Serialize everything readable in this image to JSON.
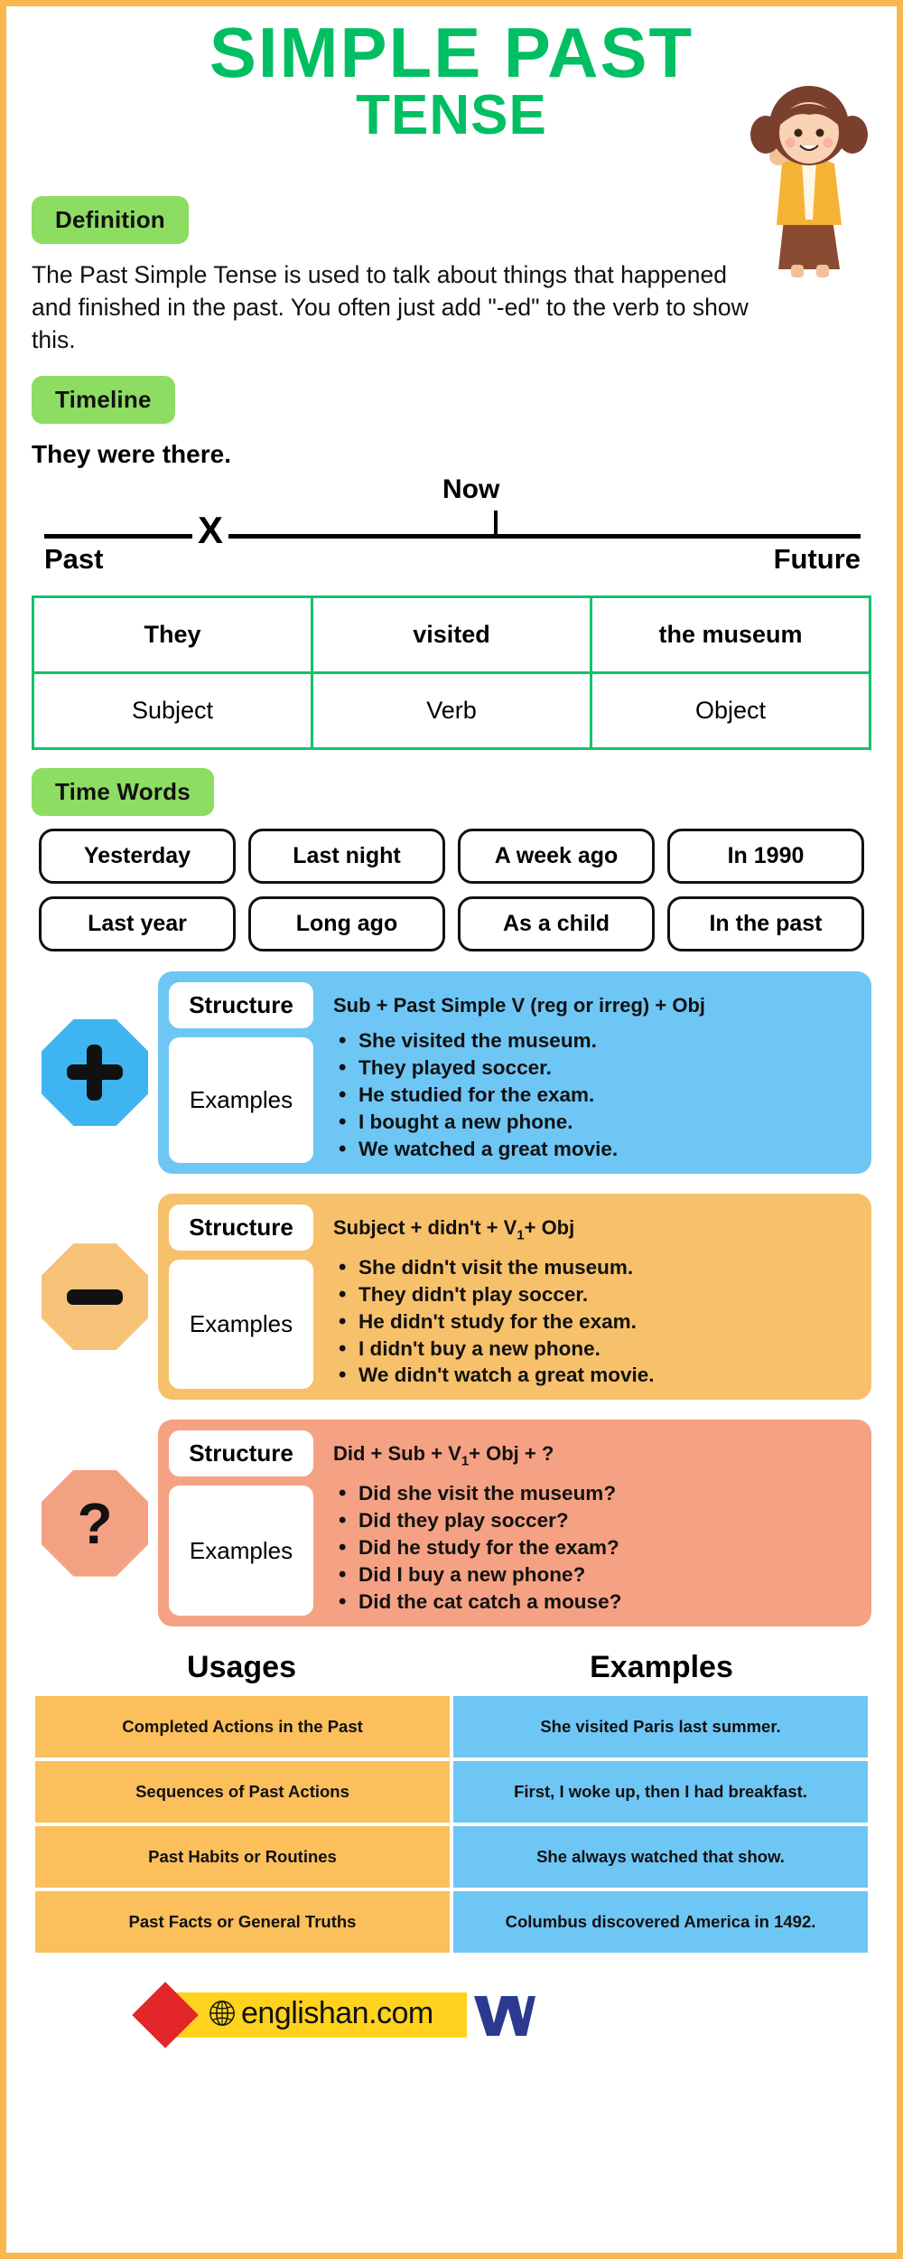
{
  "title": {
    "line1": "SIMPLE PAST",
    "line2": "TENSE"
  },
  "definition": {
    "badge": "Definition",
    "text": "The Past Simple Tense is used to talk about things that happened and finished in the past. You often just add \"-ed\" to the verb to show this."
  },
  "timeline": {
    "badge": "Timeline",
    "sentence": "They were there.",
    "now_label": "Now",
    "past_label": "Past",
    "future_label": "Future",
    "marker": "X"
  },
  "svo_table": {
    "examples": [
      "They",
      "visited",
      "the museum"
    ],
    "labels": [
      "Subject",
      "Verb",
      "Object"
    ]
  },
  "time_words": {
    "badge": "Time Words",
    "row1": [
      "Yesterday",
      "Last night",
      "A week ago",
      "In 1990"
    ],
    "row2": [
      "Last year",
      "Long ago",
      "As a child",
      "In the past"
    ]
  },
  "forms": [
    {
      "sign": "plus-icon",
      "structure_label": "Structure",
      "examples_label": "Examples",
      "structure": "Sub + Past Simple V (reg or irreg) + Obj",
      "examples": [
        "She visited the museum.",
        "They played soccer.",
        "He studied for the exam.",
        "I bought a new phone.",
        "We watched a great movie."
      ],
      "panel_color": "#6ec6f5",
      "sign_color": "#3eb4f0"
    },
    {
      "sign": "minus-icon",
      "structure_label": "Structure",
      "examples_label": "Examples",
      "structure_prefix": "Subject + didn't + V",
      "structure_sub": "1",
      "structure_suffix": "+ Obj",
      "structure": "Subject + didn't + V1+ Obj",
      "examples": [
        "She didn't visit the museum.",
        " They didn't play soccer.",
        " He didn't study for the exam.",
        "I didn't buy a new phone.",
        "We didn't watch a great movie."
      ],
      "panel_color": "#f7c06a",
      "sign_color": "#f6c278"
    },
    {
      "sign": "question-icon",
      "structure_label": "Structure",
      "examples_label": "Examples",
      "structure_prefix": "Did + Sub + V",
      "structure_sub": "1",
      "structure_suffix": "+ Obj + ?",
      "structure": "Did + Sub + V1+ Obj + ?",
      "examples": [
        "Did she visit the museum?",
        "Did they play soccer?",
        "Did he study for the exam?",
        "Did I buy a new phone?",
        "Did the cat catch a mouse?"
      ],
      "panel_color": "#f5a183",
      "sign_color": "#f3a183"
    }
  ],
  "usages": {
    "col1_header": "Usages",
    "col2_header": "Examples",
    "rows": [
      {
        "usage": "Completed Actions in the Past",
        "example": "She visited Paris last summer."
      },
      {
        "usage": "Sequences of Past Actions",
        "example": "First, I woke up, then I had breakfast."
      },
      {
        "usage": "Past Habits or Routines",
        "example": "She always watched that show."
      },
      {
        "usage": "Past Facts or General Truths",
        "example": "Columbus discovered America in 1492."
      }
    ]
  },
  "footer": {
    "brand": "englishan.com"
  },
  "colors": {
    "title_green": "#00bf63",
    "badge_green": "#8ddd63",
    "border_orange": "#f8b84e",
    "table_green": "#16c16c",
    "blue": "#6ec6f5",
    "amber": "#f7c06a",
    "salmon": "#f5a183",
    "usage_orange": "#fbbf5c",
    "footer_yellow": "#ffd21e",
    "footer_red": "#e3262a",
    "footer_navy": "#2b3a8f"
  }
}
